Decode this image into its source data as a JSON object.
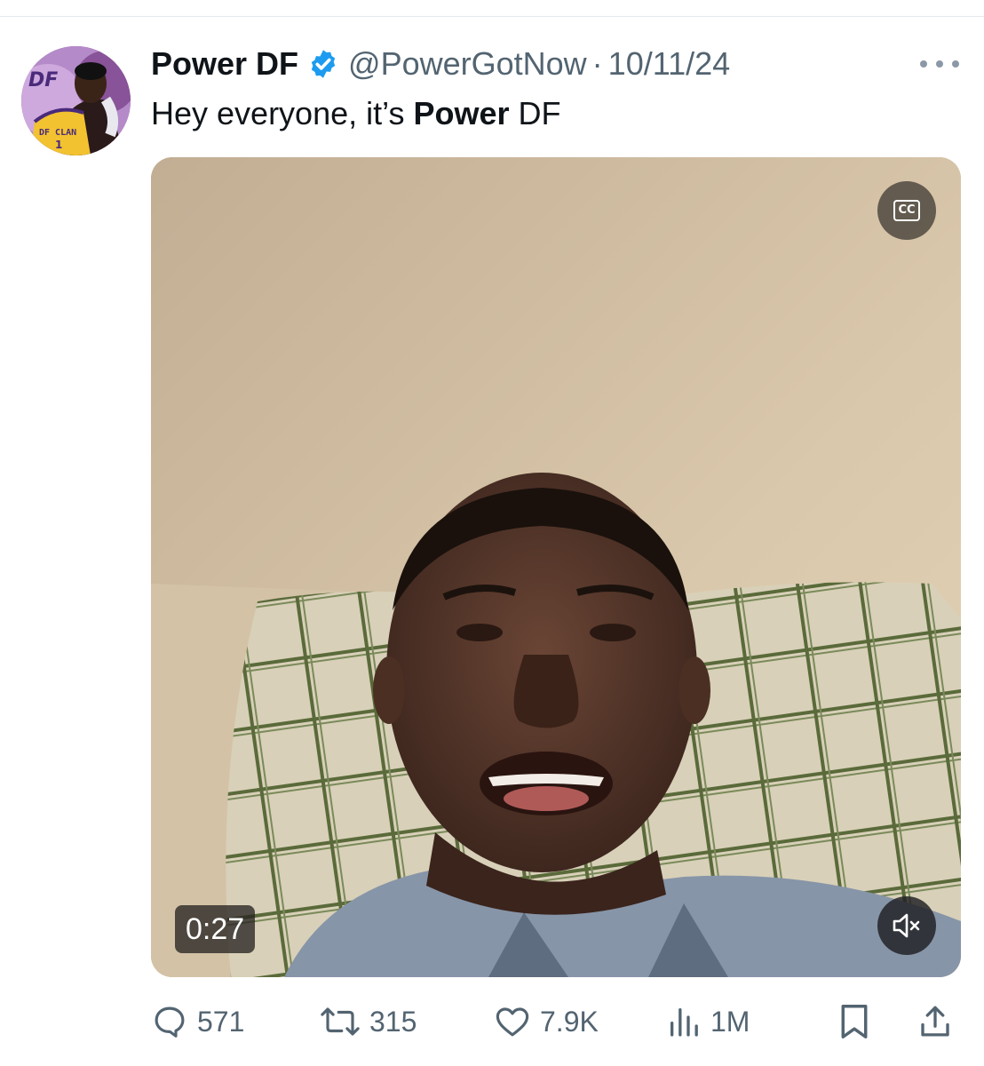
{
  "tweet": {
    "display_name": "Power DF",
    "handle": "@PowerGotNow",
    "separator": "·",
    "date": "10/11/24",
    "text_prefix": "Hey everyone, it’s ",
    "text_bold": "Power",
    "text_suffix": " DF",
    "avatar": {
      "logo_text": "DF",
      "jersey_text": "DF CLAN",
      "jersey_number": "1"
    },
    "verified": true
  },
  "video": {
    "duration": "0:27",
    "cc_label": "CC",
    "muted": true
  },
  "actions": {
    "replies": "571",
    "reposts": "315",
    "likes": "7.9K",
    "views": "1M"
  },
  "colors": {
    "verified_blue": "#1d9bf0",
    "secondary_text": "#536471",
    "primary_text": "#0f1419"
  },
  "icons": [
    "verified-badge-icon",
    "more-options-icon",
    "cc-icon",
    "mute-icon",
    "reply-icon",
    "repost-icon",
    "like-icon",
    "views-icon",
    "bookmark-icon",
    "share-icon"
  ]
}
